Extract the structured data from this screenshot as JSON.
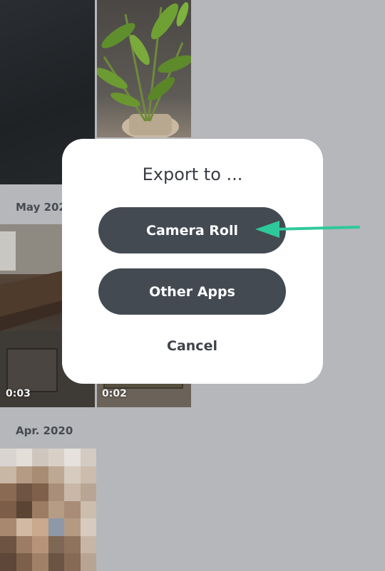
{
  "gallery": {
    "sections": [
      {
        "date_label": "May 2020"
      },
      {
        "date_label": "Apr. 2020"
      }
    ],
    "videos": [
      {
        "duration": "0:03"
      },
      {
        "duration": "0:02"
      }
    ]
  },
  "export_dialog": {
    "title": "Export to ...",
    "buttons": {
      "camera_roll": "Camera Roll",
      "other_apps": "Other Apps",
      "cancel": "Cancel"
    }
  },
  "annotation": {
    "arrow_color": "#2ec99a",
    "points_to": "camera_roll"
  },
  "colors": {
    "backdrop": "#b5b7bb",
    "button_bg": "#444a52",
    "dialog_bg": "#ffffff"
  }
}
